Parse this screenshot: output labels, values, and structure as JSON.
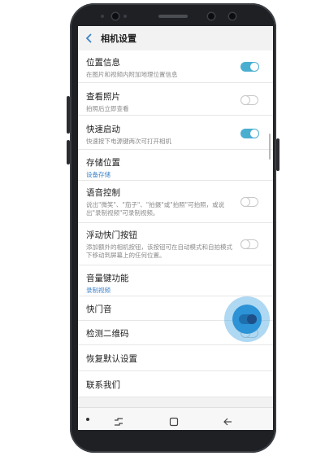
{
  "header": {
    "title": "相机设置"
  },
  "settings": [
    {
      "title": "位置信息",
      "subtitle": "在图片和视频内附加地理位置信息",
      "toggle": "on"
    },
    {
      "title": "查看照片",
      "subtitle": "拍照后立即查看",
      "toggle": "off"
    },
    {
      "title": "快速启动",
      "subtitle": "快速按下电源键两次可打开相机",
      "toggle": "on"
    },
    {
      "title": "存储位置",
      "value": "设备存储"
    },
    {
      "title": "语音控制",
      "subtitle": "说出\"微笑\"、\"茄子\"、\"拍摄\"或\"拍照\"可拍照，或说出\"录制视频\"可录制视频。",
      "toggle": "off"
    },
    {
      "title": "浮动快门按钮",
      "subtitle": "添加额外的相机按钮，该按钮可在自动模式和自拍模式下移动到屏幕上的任何位置。",
      "toggle": "off"
    },
    {
      "title": "音量键功能",
      "value": "录制视频"
    },
    {
      "title": "快门音",
      "toggle": "on"
    },
    {
      "title": "检测二维码",
      "toggle": "off"
    },
    {
      "title": "恢复默认设置"
    },
    {
      "title": "联系我们"
    }
  ],
  "icons": {
    "back": "chevron-left-icon",
    "recent": "recent-apps-icon",
    "home": "home-icon",
    "nav_back": "back-arrow-icon"
  },
  "colors": {
    "accent": "#4aaed0",
    "link": "#3d83c9",
    "tap": "#2c93d6"
  }
}
